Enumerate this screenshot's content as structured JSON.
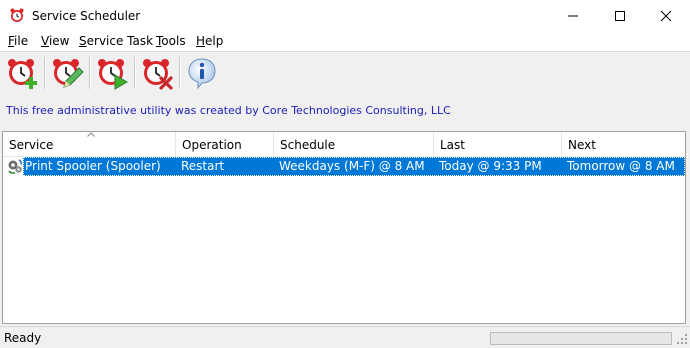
{
  "window": {
    "title": "Service Scheduler"
  },
  "menu": [
    {
      "label": "File",
      "accel": "F",
      "rest": "ile"
    },
    {
      "label": "View",
      "accel": "V",
      "rest": "iew"
    },
    {
      "label": "Service Task",
      "accel": "S",
      "rest": "ervice Task"
    },
    {
      "label": "Tools",
      "accel": "T",
      "rest": "ools"
    },
    {
      "label": "Help",
      "accel": "H",
      "rest": "elp"
    }
  ],
  "toolbar": {
    "buttons": [
      {
        "name": "add-task-button",
        "icon": "alarm-clock-add-icon"
      },
      {
        "name": "edit-task-button",
        "icon": "alarm-clock-edit-icon"
      },
      {
        "name": "run-task-button",
        "icon": "alarm-clock-run-icon"
      },
      {
        "name": "delete-task-button",
        "icon": "alarm-clock-delete-icon"
      },
      {
        "name": "about-button",
        "icon": "info-icon"
      }
    ]
  },
  "info_line": "This free administrative utility was created by Core Technologies Consulting, LLC",
  "list": {
    "columns": [
      "Service",
      "Operation",
      "Schedule",
      "Last",
      "Next"
    ],
    "sorted_column": "Service",
    "rows": [
      {
        "icon": "service-gears-icon",
        "service": "Print Spooler (Spooler)",
        "operation": "Restart",
        "schedule": "Weekdays (M-F) @ 8 AM",
        "last": "Today @ 9:33 PM",
        "next": "Tomorrow @ 8 AM",
        "selected": true
      }
    ]
  },
  "status": {
    "text": "Ready"
  },
  "colors": {
    "selection": "#0078d7",
    "info_text": "#1d1db8",
    "clock_red": "#d9262b",
    "add_green": "#3fae29"
  }
}
